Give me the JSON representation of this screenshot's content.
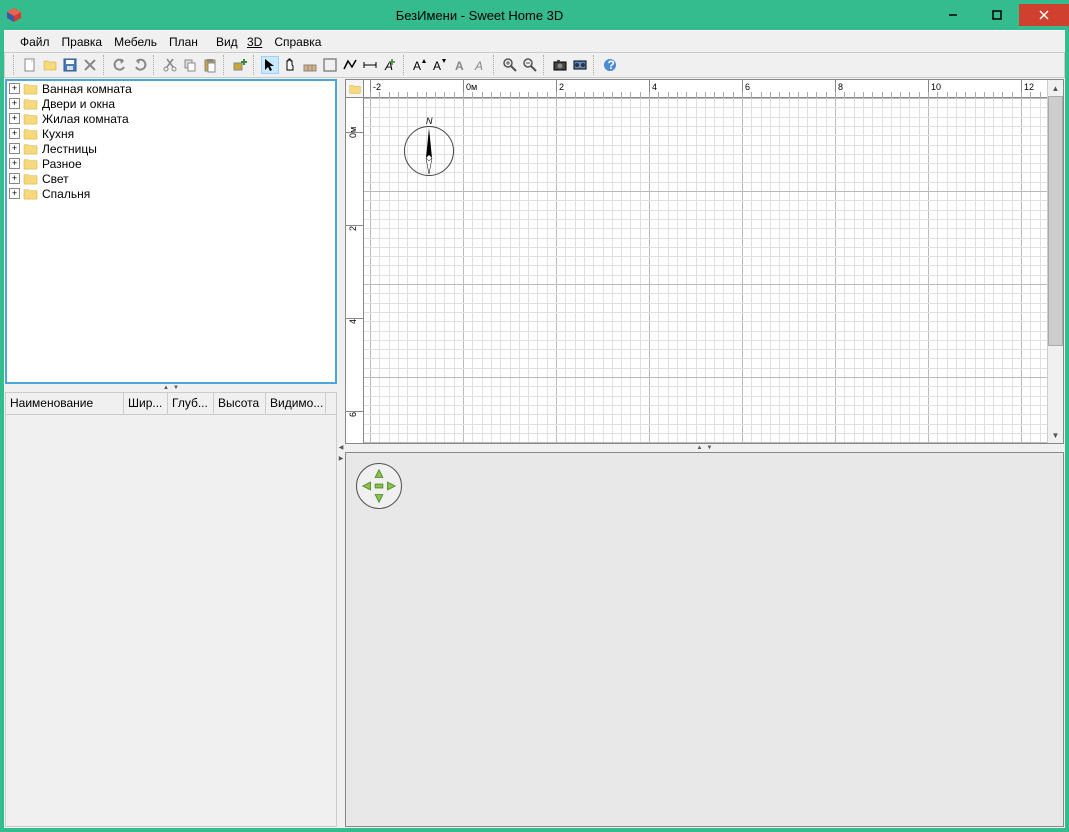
{
  "window": {
    "title": "БезИмени - Sweet Home 3D"
  },
  "menu": {
    "file": "Файл",
    "edit": "Правка",
    "furniture": "Мебель",
    "plan": "План",
    "view3d_prefix": "Вид ",
    "view3d_u": "3D",
    "help": "Справка"
  },
  "catalog": {
    "items": [
      {
        "label": "Ванная комната"
      },
      {
        "label": "Двери и окна"
      },
      {
        "label": "Жилая комната"
      },
      {
        "label": "Кухня"
      },
      {
        "label": "Лестницы"
      },
      {
        "label": "Разное"
      },
      {
        "label": "Свет"
      },
      {
        "label": "Спальня"
      }
    ]
  },
  "table": {
    "col_name": "Наименование",
    "col_width": "Шир...",
    "col_depth": "Глуб...",
    "col_height": "Высота",
    "col_visible": "Видимо..."
  },
  "ruler": {
    "h_labels": [
      {
        "pos": 6,
        "text": "-2"
      },
      {
        "pos": 99,
        "text": "0м"
      },
      {
        "pos": 192,
        "text": "2"
      },
      {
        "pos": 285,
        "text": "4"
      },
      {
        "pos": 378,
        "text": "6"
      },
      {
        "pos": 471,
        "text": "8"
      },
      {
        "pos": 564,
        "text": "10"
      },
      {
        "pos": 657,
        "text": "12"
      }
    ],
    "v_labels": [
      {
        "pos": 52,
        "text": "0м"
      },
      {
        "pos": 145,
        "text": "2"
      },
      {
        "pos": 238,
        "text": "4"
      },
      {
        "pos": 331,
        "text": "6"
      }
    ]
  },
  "compass": {
    "north": "N"
  }
}
